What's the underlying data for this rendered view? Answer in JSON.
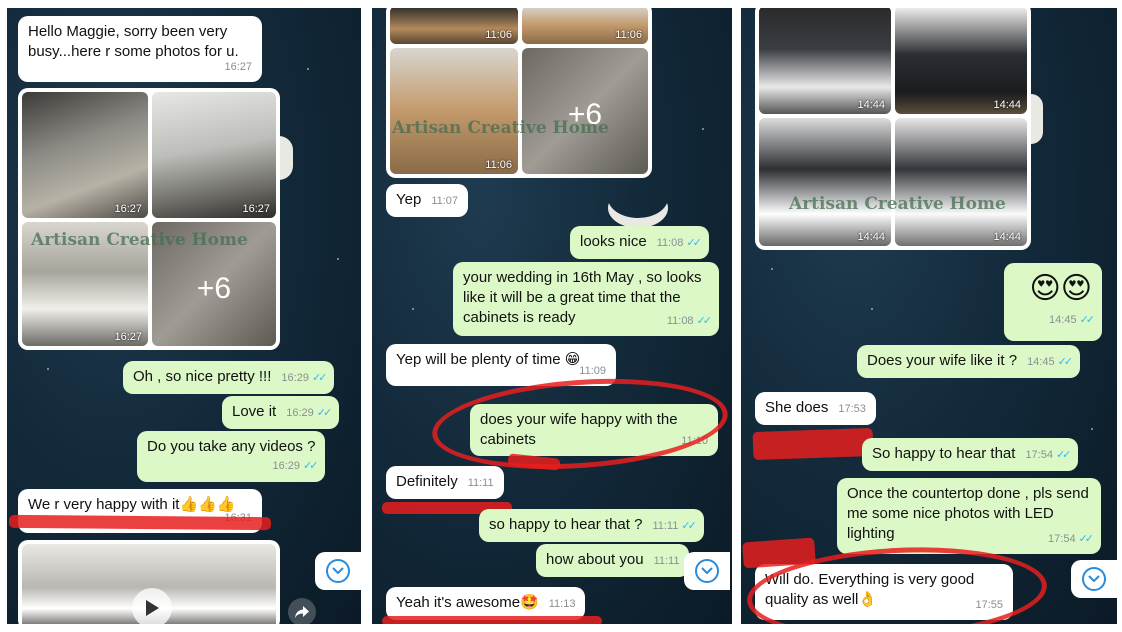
{
  "watermark": "Artisan Creative Home",
  "colors": {
    "incoming": "#ffffff",
    "outgoing": "#dcf8c6",
    "read_ticks": "#34b7f1",
    "annotation": "#e61e1e"
  },
  "icons": {
    "read_receipt": "double-check-icon",
    "scroll_down": "chevron-down-icon",
    "forward": "forward-icon",
    "play": "play-icon"
  },
  "panel1": {
    "msg1": {
      "text": "Hello Maggie, sorry been very busy...here r some photos for u.",
      "time": "16:27"
    },
    "album": {
      "times": [
        "16:27",
        "16:27",
        "16:27"
      ],
      "more": "+6"
    },
    "msg2": {
      "text": "Oh , so nice pretty !!!",
      "time": "16:29"
    },
    "msg3": {
      "text": "Love it",
      "time": "16:29"
    },
    "msg4": {
      "text": "Do you take any videos ?",
      "time": "16:29"
    },
    "msg5": {
      "text": "We r very happy with it👍👍👍",
      "time": "16:31"
    }
  },
  "panel2": {
    "album": {
      "times": [
        "11:06",
        "11:06",
        "11:06"
      ],
      "more": "+6"
    },
    "msg1": {
      "text": "Yep",
      "time": "11:07"
    },
    "msg2": {
      "text": "looks nice",
      "time": "11:08"
    },
    "msg3": {
      "text": "your wedding in 16th May , so looks like it will be a great time that the cabinets is ready",
      "time": "11:08"
    },
    "msg4": {
      "text": "Yep will be plenty of time 😁",
      "time": "11:09"
    },
    "msg5": {
      "text": "does your wife happy with the cabinets",
      "time": "11:10"
    },
    "msg6": {
      "text": "Definitely",
      "time": "11:11"
    },
    "msg7": {
      "text": "so happy to hear that ?",
      "time": "11:11"
    },
    "msg8": {
      "text": "how about you",
      "time": "11:11"
    },
    "msg9": {
      "text": "Yeah it's awesome🤩",
      "time": "11:13"
    }
  },
  "panel3": {
    "album": {
      "times": [
        "14:44",
        "14:44",
        "14:44",
        "14:44"
      ]
    },
    "msg1": {
      "text": "😍😍",
      "time": "14:45"
    },
    "msg2": {
      "text": "Does your wife like it ?",
      "time": "14:45"
    },
    "msg3": {
      "text": "She does",
      "time": "17:53"
    },
    "msg4": {
      "text": "So happy to hear that",
      "time": "17:54"
    },
    "msg5": {
      "text": "Once the countertop done , pls send me some nice photos with LED lighting",
      "time": "17:54"
    },
    "msg6": {
      "text": "Will do. Everything is very good quality as well👌",
      "time": "17:55"
    }
  }
}
